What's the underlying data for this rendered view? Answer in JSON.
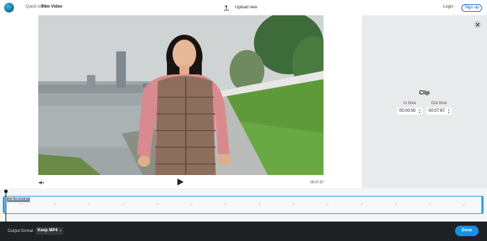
{
  "header": {
    "breadcrumb": [
      "Quick tools",
      "/",
      "Trim Video"
    ],
    "upload_label": "Upload new",
    "login_label": "Login",
    "signup_label": "Sign up"
  },
  "player": {
    "current_time": "00:07:67"
  },
  "panel": {
    "title": "Clip",
    "in_time_label": "In time",
    "in_time_value": "00:00:00",
    "out_time_label": "Out time",
    "out_time_value": "00:07:67"
  },
  "timeline": {
    "clip_label": "Clip 00:07:67"
  },
  "footer": {
    "output_format_label": "Output format",
    "format_value": "Keep MP4",
    "done_label": "Done"
  },
  "colors": {
    "accent": "#1592e6",
    "track_border": "#2a9ee0",
    "footer_bg": "#1f2124",
    "panel_bg": "#e9eaec"
  },
  "icons": [
    "logo-icon",
    "upload-icon",
    "mute-icon",
    "play-icon",
    "close-icon",
    "spinner-icon",
    "caret-down-icon"
  ]
}
